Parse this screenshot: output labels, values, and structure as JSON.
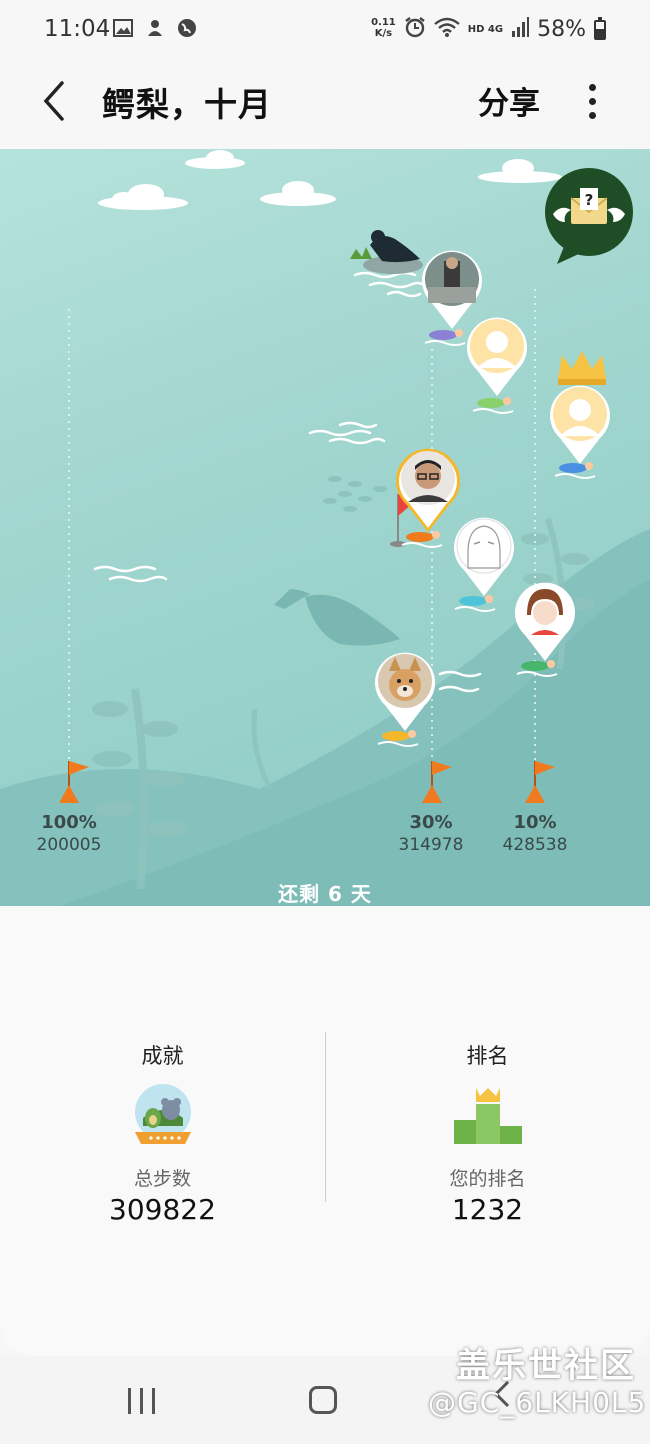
{
  "status_bar": {
    "time": "11:04",
    "net_speed_value": "0.11",
    "net_speed_unit": "K/s",
    "network": "HD 4G",
    "battery_percent": "58%",
    "battery_level": 0.58
  },
  "app_bar": {
    "back_icon": "chevron-left-icon",
    "title": "鳄梨，十月",
    "share_label": "分享",
    "more_icon": "more-vertical-icon"
  },
  "challenge": {
    "remaining_text": "还剩 6 天",
    "milestones": [
      {
        "percent": "100%",
        "steps": "200005"
      },
      {
        "percent": "30%",
        "steps": "314978"
      },
      {
        "percent": "10%",
        "steps": "428538"
      }
    ],
    "mail_icon": "winged-envelope-question-icon"
  },
  "stats": {
    "achievement_title": "成就",
    "achievement_label": "总步数",
    "achievement_value": "309822",
    "rank_title": "排名",
    "rank_label": "您的排名",
    "rank_value": "1232"
  },
  "watermark": {
    "line1": "盖乐世社区",
    "line2": "@GC_6LKH0L5"
  },
  "colors": {
    "scene_bg": "#a3d7d0",
    "flag": "#f07a1e",
    "gold": "#f5c242",
    "rank_green": "#6db34a"
  }
}
